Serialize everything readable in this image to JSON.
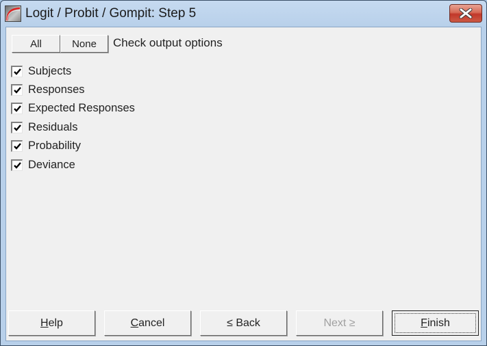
{
  "window": {
    "title": "Logit / Probit / Gompit: Step 5",
    "icon": "app-curve-icon",
    "close_icon": "close-icon"
  },
  "header": {
    "all_label": "All",
    "none_label": "None",
    "instruction": "Check output options"
  },
  "options": [
    {
      "label": "Subjects",
      "checked": true
    },
    {
      "label": "Responses",
      "checked": true
    },
    {
      "label": "Expected Responses",
      "checked": true
    },
    {
      "label": "Residuals",
      "checked": true
    },
    {
      "label": "Probability",
      "checked": true
    },
    {
      "label": "Deviance",
      "checked": true
    }
  ],
  "footer": {
    "help": {
      "label": "Help",
      "mnemonic": "H",
      "rest": "elp",
      "enabled": true
    },
    "cancel": {
      "label": "Cancel",
      "mnemonic": "C",
      "rest": "ancel",
      "enabled": true
    },
    "back": {
      "label": "< Back",
      "mnemonic": "≤",
      "rest": " Back",
      "enabled": true
    },
    "next": {
      "label": "Next >",
      "prefix": "Next ",
      "mnemonic": "≥",
      "enabled": false
    },
    "finish": {
      "label": "Finish",
      "mnemonic": "F",
      "rest": "inish",
      "enabled": true,
      "default": true
    }
  }
}
